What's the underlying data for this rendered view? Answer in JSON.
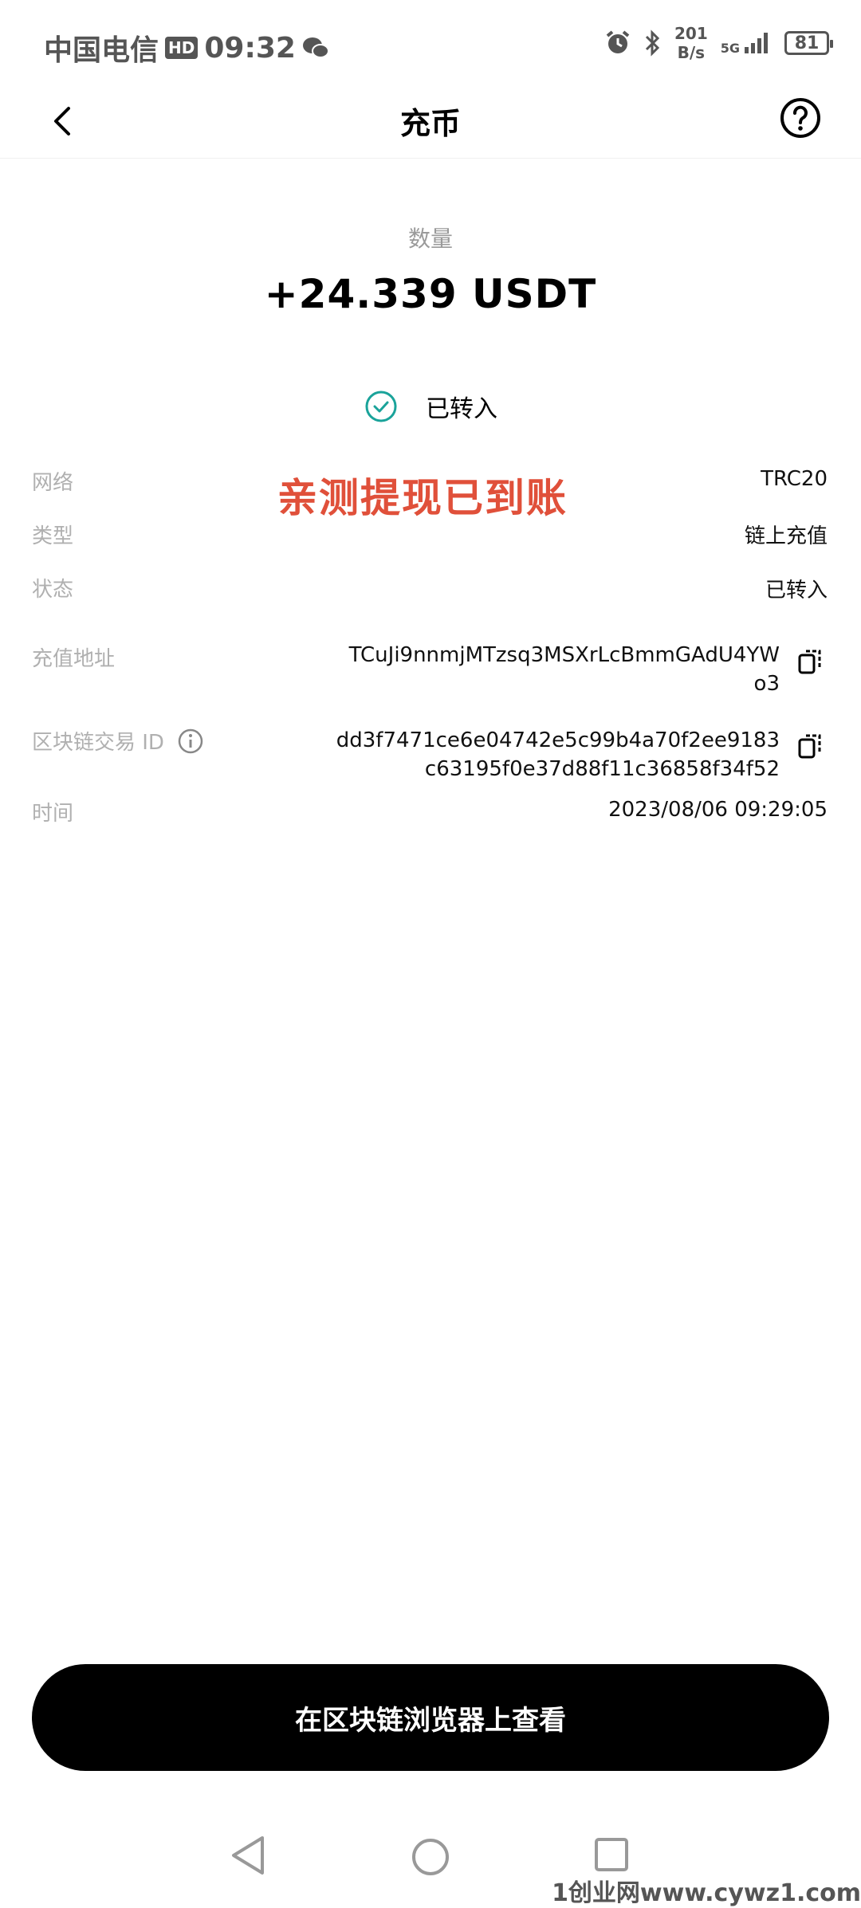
{
  "status_bar": {
    "carrier": "中国电信",
    "hd": "HD",
    "time": "09:32",
    "speed_value": "201",
    "speed_unit": "B/s",
    "network": "5G",
    "battery": "81"
  },
  "header": {
    "title": "充币"
  },
  "amount": {
    "label": "数量",
    "value": "+24.339 USDT"
  },
  "status": {
    "text": "已转入"
  },
  "overlay_text": "亲测提现已到账",
  "details": {
    "network_label": "网络",
    "network_value": "TRC20",
    "type_label": "类型",
    "type_value": "链上充值",
    "status_label": "状态",
    "status_value": "已转入",
    "address_label": "充值地址",
    "address_line1": "TCuJi9nnmjMTzsq3MSXrLcBmmGAdU4YW",
    "address_line2": "o3",
    "txid_label": "区块链交易 ID",
    "txid_line1": "dd3f7471ce6e04742e5c99b4a70f2ee9183",
    "txid_line2": "c63195f0e37d88f11c36858f34f52",
    "time_label": "时间",
    "time_value": "2023/08/06 09:29:05"
  },
  "button": {
    "label": "在区块链浏览器上查看"
  },
  "footer_watermark": "1创业网www.cywz1.com",
  "colors": {
    "accent_teal": "#1aa39a",
    "watermark_red": "#e0503a"
  }
}
